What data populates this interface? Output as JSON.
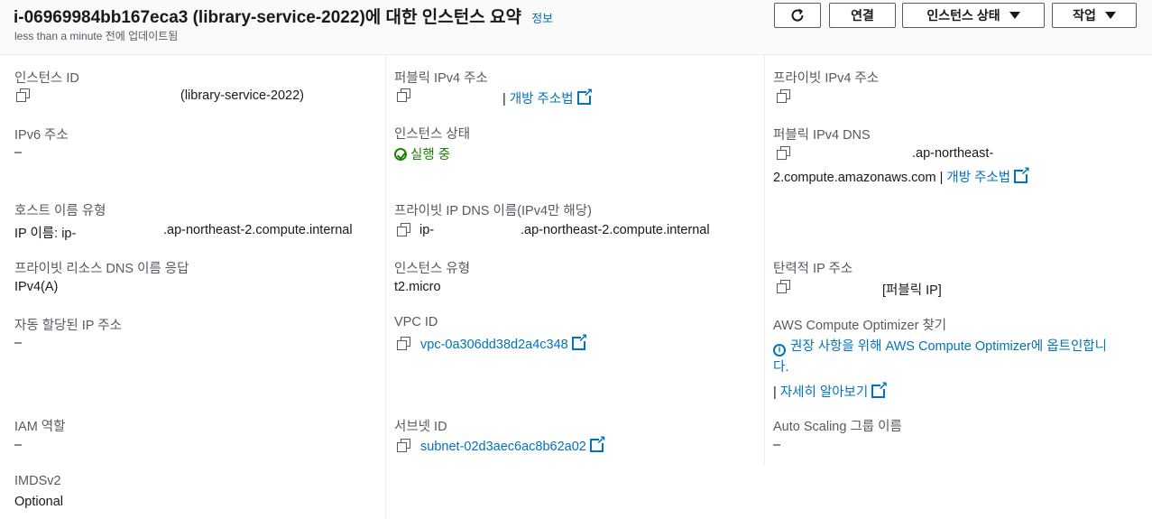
{
  "header": {
    "title": "i-06969984bb167eca3 (library-service-2022)에 대한 인스턴스 요약",
    "info_link": "정보",
    "subtitle": "less than a minute 전에 업데이트됨",
    "buttons": {
      "refresh_icon": "refresh-icon",
      "connect": "연결",
      "instance_state": "인스턴스 상태",
      "actions": "작업"
    }
  },
  "col1": {
    "instance_id": {
      "label": "인스턴스 ID",
      "value": "(library-service-2022)"
    },
    "ipv6": {
      "label": "IPv6 주소",
      "value": "–"
    },
    "hostname_type": {
      "label": "호스트 이름 유형",
      "value_prefix": "IP 이름: ip-",
      "value_suffix": ".ap-northeast-2.compute.internal"
    },
    "private_dns_answer": {
      "label": "프라이빗 리소스 DNS 이름 응답",
      "value": "IPv4(A)"
    },
    "auto_ip": {
      "label": "자동 할당된 IP 주소",
      "value": "–"
    },
    "iam_role": {
      "label": "IAM 역할",
      "value": "–"
    },
    "imdsv2": {
      "label": "IMDSv2",
      "value": "Optional"
    }
  },
  "col2": {
    "public_ipv4": {
      "label": "퍼블릭 IPv4 주소",
      "sep": "|",
      "link": "개방 주소법"
    },
    "instance_state": {
      "label": "인스턴스 상태",
      "value": "실행 중"
    },
    "private_ip_dns": {
      "label": "프라이빗 IP DNS 이름(IPv4만 해당)",
      "value_prefix": "ip-",
      "value_suffix": ".ap-northeast-2.compute.internal"
    },
    "instance_type": {
      "label": "인스턴스 유형",
      "value": "t2.micro"
    },
    "vpc_id": {
      "label": "VPC ID",
      "value": "vpc-0a306dd38d2a4c348"
    },
    "subnet_id": {
      "label": "서브넷 ID",
      "value": "subnet-02d3aec6ac8b62a02"
    }
  },
  "col3": {
    "private_ipv4": {
      "label": "프라이빗 IPv4 주소"
    },
    "public_ipv4_dns": {
      "label": "퍼블릭 IPv4 DNS",
      "line1": ".ap-northeast-",
      "line2": "2.compute.amazonaws.com",
      "sep": "|",
      "link": "개방 주소법"
    },
    "elastic_ip": {
      "label": "탄력적 IP 주소",
      "value": "[퍼블릭 IP]"
    },
    "compute_optimizer": {
      "label": "AWS Compute Optimizer 찾기",
      "line1_link_a": "권장 사항을 위해 ",
      "line1_link_b": "AWS Compute Optimizer",
      "line1_link_c": "에 옵트인합니",
      "line2": "다.",
      "sep": "|",
      "learn_more": "자세히 알아보기"
    },
    "auto_scaling": {
      "label": "Auto Scaling 그룹 이름",
      "value": "–"
    }
  },
  "colors": {
    "link": "#0073bb",
    "success": "#1d8102",
    "label": "#545b64"
  }
}
